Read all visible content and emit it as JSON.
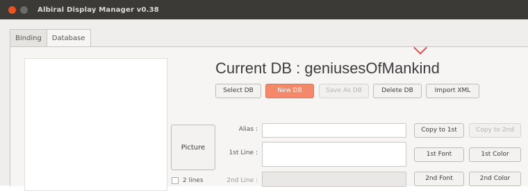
{
  "window": {
    "title": "Albiral Display Manager v0.38"
  },
  "tabs": [
    {
      "label": "Binding"
    },
    {
      "label": "Database"
    }
  ],
  "database": {
    "title": "Current DB : geniusesOfMankind",
    "buttons": {
      "select": "Select DB",
      "new": "New DB",
      "save_as": "Save As DB",
      "delete": "Delete DB",
      "import": "Import XML"
    }
  },
  "editor": {
    "picture_label": "Picture",
    "two_lines_label": "2 lines",
    "alias_label": "Alias :",
    "line1_label": "1st Line :",
    "line2_label": "2nd Line :",
    "alias_value": "",
    "line1_value": "",
    "line2_value": "",
    "copy_to_1st": "Copy to 1st",
    "copy_to_2nd": "Copy to 2nd",
    "font_1st": "1st Font",
    "color_1st": "1st Color",
    "font_2nd": "2nd Font",
    "color_2nd": "2nd Color"
  }
}
